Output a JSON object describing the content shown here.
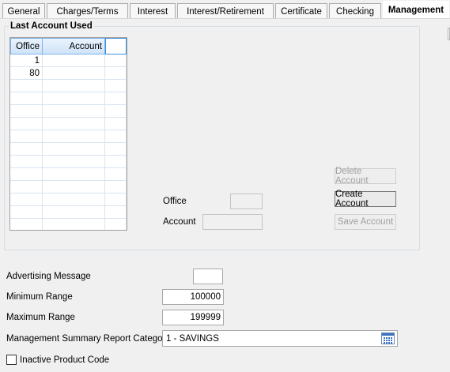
{
  "tabs": [
    {
      "label": "General"
    },
    {
      "label": "Charges/Terms"
    },
    {
      "label": "Interest"
    },
    {
      "label": "Interest/Retirement"
    },
    {
      "label": "Certificate"
    },
    {
      "label": "Checking"
    },
    {
      "label": "Management"
    }
  ],
  "active_tab": "Management",
  "last_account": {
    "title": "Last Account Used",
    "columns": [
      "Office",
      "Account",
      ""
    ],
    "rows": [
      {
        "office": "1",
        "account": ""
      },
      {
        "office": "80",
        "account": ""
      }
    ]
  },
  "form": {
    "office_label": "Office",
    "office_value": "",
    "account_label": "Account",
    "account_value": ""
  },
  "buttons": {
    "delete": "Delete Account",
    "create": "Create Account",
    "save": "Save Account"
  },
  "fields": {
    "advertising_label": "Advertising Message",
    "advertising_value": "",
    "min_label": "Minimum Range",
    "min_value": "100000",
    "max_label": "Maximum Range",
    "max_value": "199999",
    "category_label": "Management Summary Report Category",
    "category_value": "1 - SAVINGS",
    "inactive_label": "Inactive Product Code"
  },
  "icons": {
    "category_picker": "calendar-grid-icon"
  }
}
